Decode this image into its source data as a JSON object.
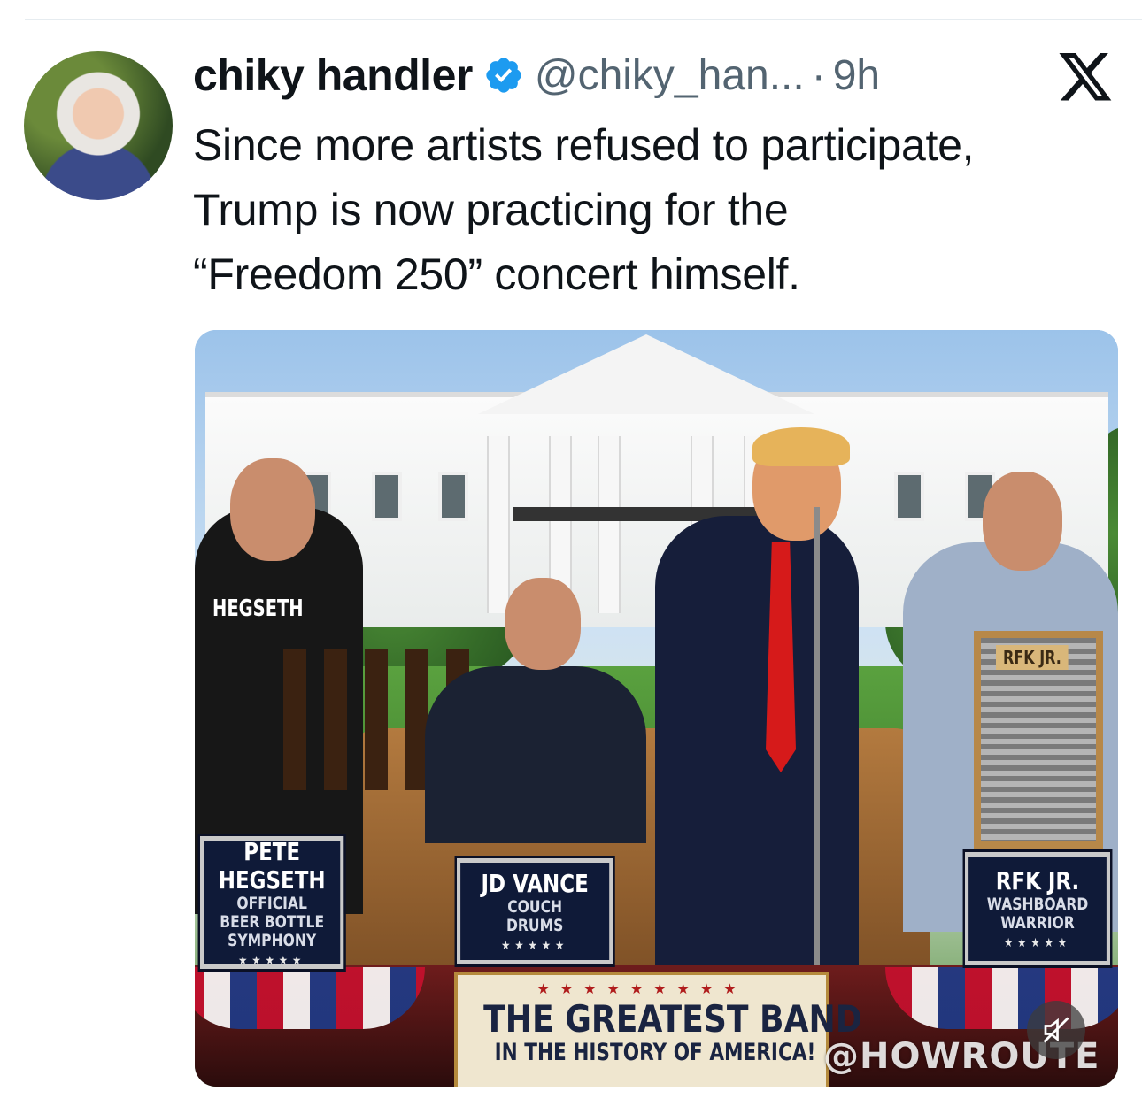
{
  "author": {
    "name": "chiky handler",
    "handle": "@chiky_han...",
    "separator": "·",
    "time": "9h"
  },
  "icons": {
    "verified": "verified-badge-icon",
    "platform": "x-logo-icon",
    "mute": "speaker-muted-icon"
  },
  "colors": {
    "verified": "#1d9bf0",
    "secondary_text": "#536471"
  },
  "tweet": {
    "lines": [
      "Since more artists refused to participate,",
      "Trump is now practicing for the",
      "“Freedom 250” concert himself."
    ]
  },
  "media": {
    "shirt_text": "HEGSETH",
    "washboard_text": "RFK JR.",
    "signs": [
      {
        "title": "PETE HEGSETH",
        "subtitle_1": "OFFICIAL",
        "subtitle_2": "BEER BOTTLE",
        "subtitle_3": "SYMPHONY",
        "stars": "★★★★★"
      },
      {
        "title": "JD VANCE",
        "subtitle_1": "COUCH",
        "subtitle_2": "DRUMS",
        "stars": "★★★★★"
      },
      {
        "title": "RFK JR.",
        "subtitle_1": "WASHBOARD",
        "subtitle_2": "WARRIOR",
        "stars": "★★★★★"
      }
    ],
    "banner": {
      "stars": "★★★★★★★★★",
      "line_1": "THE GREATEST BAND",
      "line_2": "IN THE HISTORY OF AMERICA!"
    },
    "watermark": "@HOWROUTE"
  }
}
